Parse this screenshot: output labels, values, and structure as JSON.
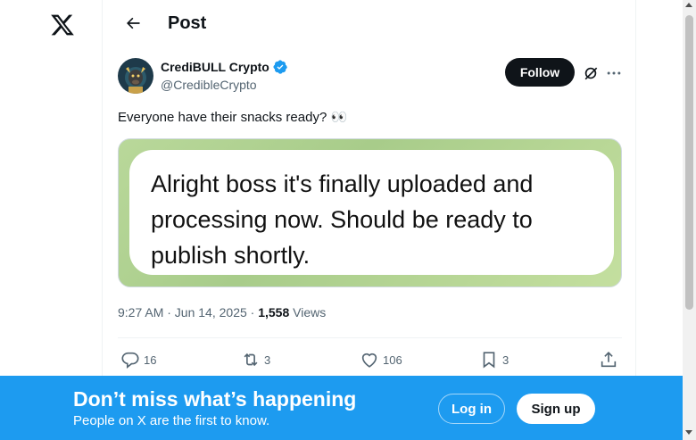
{
  "header": {
    "title": "Post"
  },
  "author": {
    "name": "CrediBULL Crypto",
    "handle": "@CredibleCrypto"
  },
  "follow_label": "Follow",
  "tweet": {
    "text": "Everyone have their snacks ready? 👀",
    "image_text": "Alright boss it's finally uploaded and processing now. Should be ready to publish shortly."
  },
  "meta": {
    "time": "9:27 AM · Jun 14, 2025 · ",
    "views_count": "1,558",
    "views_label": " Views"
  },
  "actions": {
    "replies": "16",
    "reposts": "3",
    "likes": "106",
    "bookmarks": "3"
  },
  "banner": {
    "title": "Don’t miss what’s happening",
    "subtitle": "People on X are the first to know.",
    "login_label": "Log in",
    "signup_label": "Sign up"
  },
  "colors": {
    "accent": "#1d9bf0",
    "text": "#0f1419",
    "muted": "#536471"
  }
}
